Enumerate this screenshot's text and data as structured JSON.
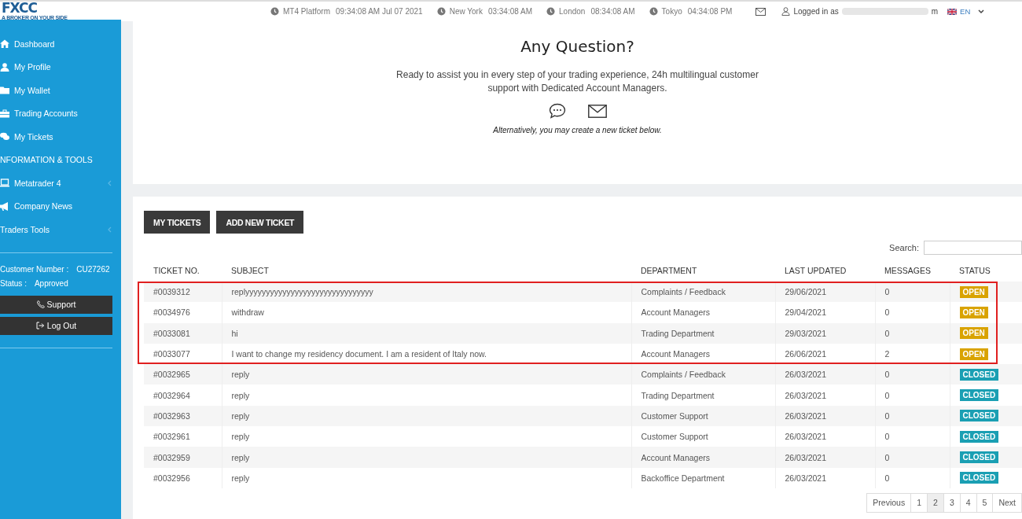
{
  "logo": {
    "name": "FXCC",
    "tagline": "A BROKER ON YOUR SIDE"
  },
  "top_bar": {
    "clocks": [
      {
        "label": "MT4 Platform",
        "time": "09:34:08 AM  Jul 07 2021"
      },
      {
        "label": "New York",
        "time": "03:34:08 AM"
      },
      {
        "label": "London",
        "time": "08:34:08 AM"
      },
      {
        "label": "Tokyo",
        "time": "04:34:08 PM"
      }
    ],
    "user": {
      "prefix": "Logged in as",
      "tail": "m"
    },
    "language": "EN"
  },
  "sidebar": {
    "items": [
      {
        "kind": "link",
        "label": "Dashboard",
        "has_submenu": false
      },
      {
        "kind": "link",
        "label": "My Profile",
        "has_submenu": false
      },
      {
        "kind": "link",
        "label": "My Wallet",
        "has_submenu": false
      },
      {
        "kind": "link",
        "label": "Trading Accounts",
        "has_submenu": false
      },
      {
        "kind": "link",
        "label": "My Tickets",
        "has_submenu": false
      },
      {
        "kind": "heading",
        "label": "NFORMATION & TOOLS",
        "has_submenu": false
      },
      {
        "kind": "link",
        "label": "Metatrader 4",
        "has_submenu": true
      },
      {
        "kind": "link",
        "label": "Company News",
        "has_submenu": false
      },
      {
        "kind": "plain",
        "label": "Traders Tools",
        "has_submenu": true
      }
    ],
    "customer_number": {
      "label": "Customer Number :",
      "value": "CU27262"
    },
    "status": {
      "label": "Status :",
      "value": "Approved"
    },
    "buttons": [
      {
        "kind": "phone",
        "label": "Support"
      },
      {
        "kind": "logout",
        "label": "Log Out"
      }
    ]
  },
  "intro": {
    "title": "Any Question?",
    "text": "Ready to assist you in every step of your trading experience, 24h multilingual customer support with Dedicated Account Managers.",
    "note": "Alternatively, you may create a new ticket below."
  },
  "tickets": {
    "buttons": [
      "MY TICKETS",
      "ADD NEW TICKET"
    ],
    "search_label": "Search:",
    "columns": [
      "TICKET NO.",
      "SUBJECT",
      "DEPARTMENT",
      "LAST UPDATED",
      "MESSAGES",
      "STATUS"
    ],
    "rows": [
      {
        "ticket": "#0039312",
        "subject": "replyyyyyyyyyyyyyyyyyyyyyyyyyyyyyyy",
        "department": "Complaints / Feedback",
        "updated": "29/06/2021",
        "messages": "0",
        "status": "OPEN",
        "color": "#d9a300",
        "highlighted": true
      },
      {
        "ticket": "#0034976",
        "subject": "withdraw",
        "department": "Account Managers",
        "updated": "29/04/2021",
        "messages": "0",
        "status": "OPEN",
        "color": "#d9a300",
        "highlighted": true
      },
      {
        "ticket": "#0033081",
        "subject": "hi",
        "department": "Trading Department",
        "updated": "29/03/2021",
        "messages": "0",
        "status": "OPEN",
        "color": "#d9a300",
        "highlighted": true
      },
      {
        "ticket": "#0033077",
        "subject": "I want to change my residency document. I am a resident of Italy now.",
        "department": "Account Managers",
        "updated": "26/06/2021",
        "messages": "2",
        "status": "OPEN",
        "color": "#d9a300",
        "highlighted": true
      },
      {
        "ticket": "#0032965",
        "subject": "reply",
        "department": "Complaints / Feedback",
        "updated": "26/03/2021",
        "messages": "0",
        "status": "CLOSED",
        "color": "#1a9fb3",
        "highlighted": false
      },
      {
        "ticket": "#0032964",
        "subject": "reply",
        "department": "Trading Department",
        "updated": "26/03/2021",
        "messages": "0",
        "status": "CLOSED",
        "color": "#1a9fb3",
        "highlighted": false
      },
      {
        "ticket": "#0032963",
        "subject": "reply",
        "department": "Customer Support",
        "updated": "26/03/2021",
        "messages": "0",
        "status": "CLOSED",
        "color": "#1a9fb3",
        "highlighted": false
      },
      {
        "ticket": "#0032961",
        "subject": "reply",
        "department": "Customer Support",
        "updated": "26/03/2021",
        "messages": "0",
        "status": "CLOSED",
        "color": "#1a9fb3",
        "highlighted": false
      },
      {
        "ticket": "#0032959",
        "subject": "reply",
        "department": "Account Managers",
        "updated": "26/03/2021",
        "messages": "0",
        "status": "CLOSED",
        "color": "#1a9fb3",
        "highlighted": false
      },
      {
        "ticket": "#0032956",
        "subject": "reply",
        "department": "Backoffice Department",
        "updated": "26/03/2021",
        "messages": "0",
        "status": "CLOSED",
        "color": "#1a9fb3",
        "highlighted": false
      }
    ],
    "pagination": [
      {
        "label": "Previous",
        "selected": false
      },
      {
        "label": "1",
        "selected": false
      },
      {
        "label": "2",
        "selected": true
      },
      {
        "label": "3",
        "selected": false
      },
      {
        "label": "4",
        "selected": false
      },
      {
        "label": "5",
        "selected": false
      },
      {
        "label": "Next",
        "selected": false
      }
    ]
  }
}
